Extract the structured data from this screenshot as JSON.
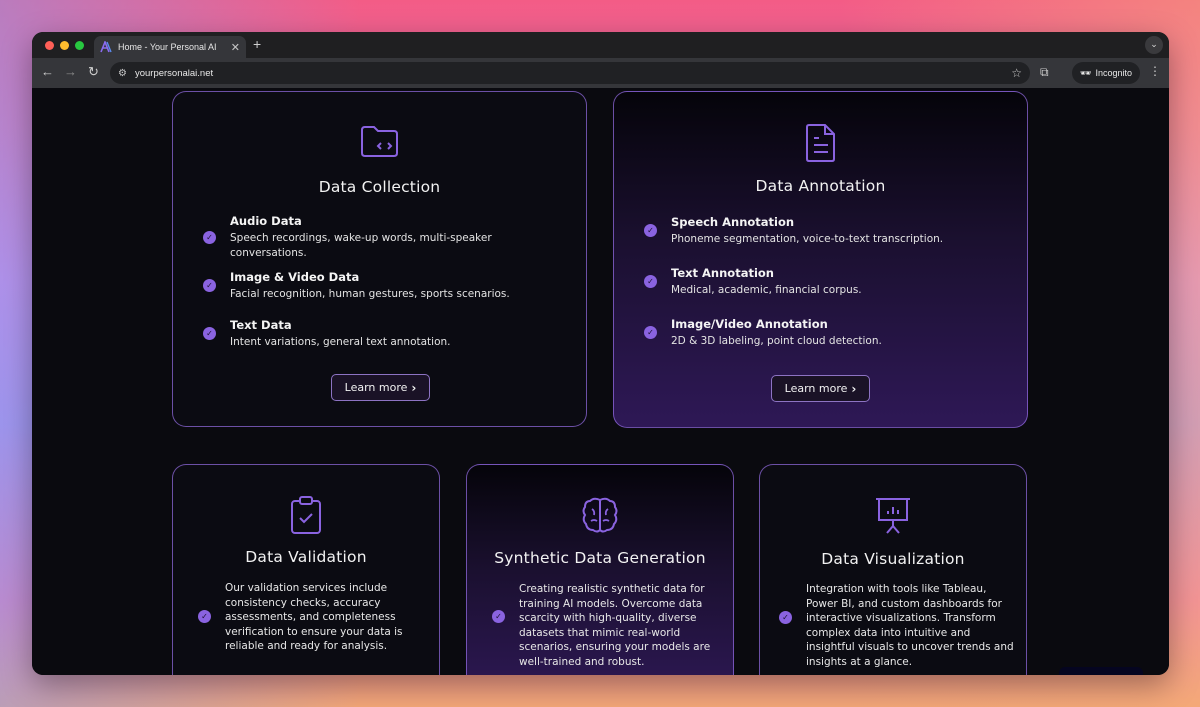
{
  "browser": {
    "tab_title": "Home - Your Personal AI",
    "url": "yourpersonalai.net",
    "incognito_label": "Incognito"
  },
  "cards_top": [
    {
      "title": "Data Collection",
      "icon": "folder-code-icon",
      "items": [
        {
          "title": "Audio Data",
          "desc": "Speech recordings, wake-up words, multi-speaker conversations."
        },
        {
          "title": "Image & Video Data",
          "desc": "Facial recognition, human gestures, sports scenarios."
        },
        {
          "title": "Text Data",
          "desc": "Intent variations, general text annotation."
        }
      ],
      "button": "Learn more"
    },
    {
      "title": "Data Annotation",
      "icon": "document-icon",
      "items": [
        {
          "title": "Speech Annotation",
          "desc": "Phoneme segmentation, voice-to-text transcription."
        },
        {
          "title": "Text Annotation",
          "desc": "Medical, academic, financial corpus."
        },
        {
          "title": "Image/Video Annotation",
          "desc": "2D & 3D labeling, point cloud detection."
        }
      ],
      "button": "Learn more"
    }
  ],
  "cards_bottom": [
    {
      "title": "Data Validation",
      "icon": "clipboard-check-icon",
      "text": "Our validation services include consistency checks, accuracy assessments, and completeness verification to ensure your data is reliable and ready for analysis."
    },
    {
      "title": "Synthetic Data Generation",
      "icon": "brain-icon",
      "text": "Creating realistic synthetic data for training AI models. Overcome data scarcity with high-quality, diverse datasets that mimic real-world scenarios, ensuring your models are well-trained and robust."
    },
    {
      "title": "Data Visualization",
      "icon": "presentation-chart-icon",
      "text": "Integration with tools like Tableau, Power BI, and custom dashboards for interactive visualizations. Transform complex data into intuitive and insightful visuals to uncover trends and insights at a glance."
    }
  ],
  "colors": {
    "accent": "#8a63e0",
    "border": "#9a6ee6",
    "background": "#0a0a0f"
  }
}
